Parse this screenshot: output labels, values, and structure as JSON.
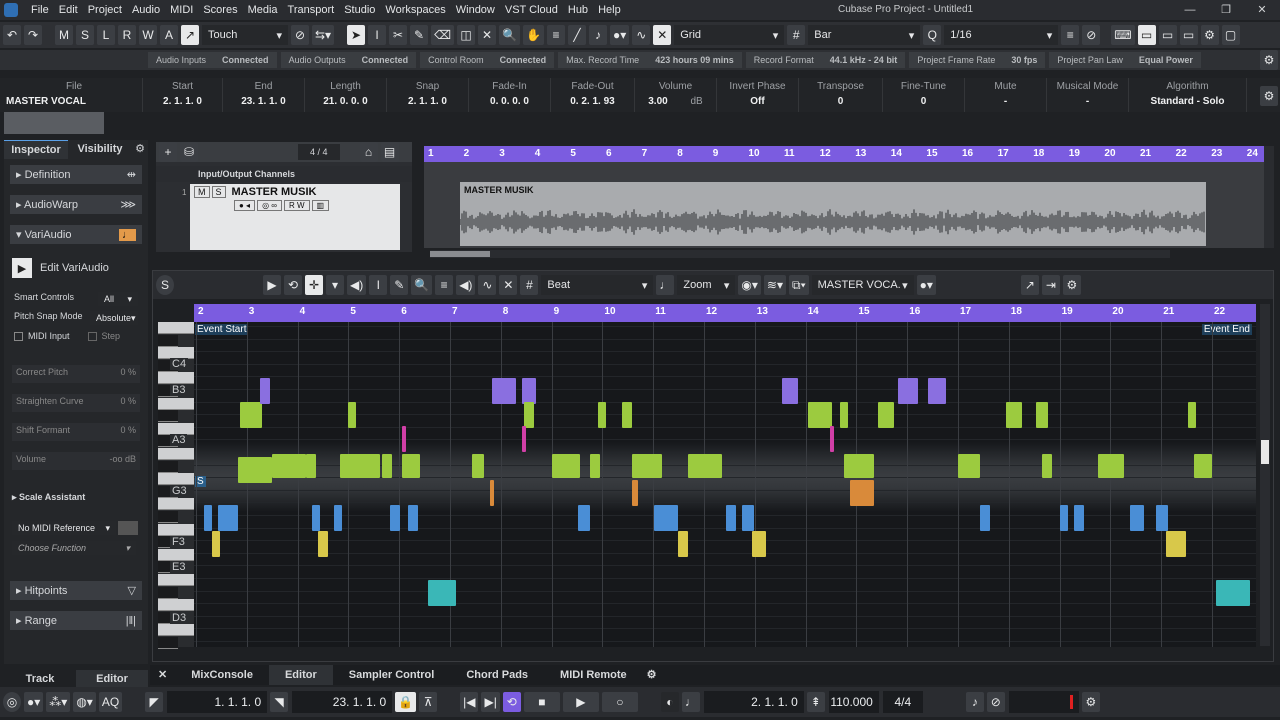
{
  "window": {
    "title": "Cubase Pro Project - Untitled1"
  },
  "menu": [
    "File",
    "Edit",
    "Project",
    "Audio",
    "MIDI",
    "Scores",
    "Media",
    "Transport",
    "Studio",
    "Workspaces",
    "Window",
    "VST Cloud",
    "Hub",
    "Help"
  ],
  "toolbar": {
    "modes": [
      "M",
      "S",
      "L",
      "R",
      "W",
      "A"
    ],
    "automation_mode": "Touch",
    "snap_type": "Grid",
    "grid_type": "Bar",
    "quantize": "1/16"
  },
  "status": [
    {
      "label": "Audio Inputs",
      "value": "Connected"
    },
    {
      "label": "Audio Outputs",
      "value": "Connected"
    },
    {
      "label": "Control Room",
      "value": "Connected"
    },
    {
      "label": "Max. Record Time",
      "value": "423 hours 09 mins"
    },
    {
      "label": "Record Format",
      "value": "44.1 kHz - 24 bit"
    },
    {
      "label": "Project Frame Rate",
      "value": "30 fps"
    },
    {
      "label": "Project Pan Law",
      "value": "Equal Power"
    }
  ],
  "infoline": [
    {
      "h": "File",
      "v": "MASTER VOCAL"
    },
    {
      "h": "Start",
      "v": "2. 1. 1. 0"
    },
    {
      "h": "End",
      "v": "23. 1. 1. 0"
    },
    {
      "h": "Length",
      "v": "21. 0. 0. 0"
    },
    {
      "h": "Snap",
      "v": "2. 1. 1. 0"
    },
    {
      "h": "Fade-In",
      "v": "0. 0. 0. 0"
    },
    {
      "h": "Fade-Out",
      "v": "0. 2. 1. 93"
    },
    {
      "h": "Volume",
      "v": "3.00"
    },
    {
      "h": "Invert Phase",
      "v": "Off"
    },
    {
      "h": "Transpose",
      "v": "0"
    },
    {
      "h": "Fine-Tune",
      "v": "0"
    },
    {
      "h": "Mute",
      "v": "-"
    },
    {
      "h": "Musical Mode",
      "v": "-"
    },
    {
      "h": "Algorithm",
      "v": "Standard - Solo"
    }
  ],
  "volume_unit": "dB",
  "inspector": {
    "tabs": [
      "Inspector",
      "Visibility"
    ],
    "sections": [
      "Definition",
      "AudioWarp",
      "VariAudio"
    ],
    "edit_variaudio": "Edit VariAudio",
    "smart_controls_label": "Smart Controls",
    "smart_controls_value": "All",
    "pitch_snap_label": "Pitch Snap Mode",
    "pitch_snap_value": "Absolute",
    "midi_input": "MIDI Input",
    "step": "Step",
    "correct_pitch": "Correct Pitch",
    "straighten_curve": "Straighten Curve",
    "shift_formant": "Shift Formant",
    "volume": "Volume",
    "pct": "0 %",
    "vol_val": "-oo dB",
    "scale_assistant": "Scale Assistant",
    "no_midi_ref": "No MIDI Reference",
    "choose_function": "Choose Function",
    "hitpoints": "Hitpoints",
    "range": "Range",
    "bottom_tabs": [
      "Track",
      "Editor"
    ]
  },
  "tracklist": {
    "counter": "4 / 4",
    "folder": "Input/Output Channels",
    "track_name": "MASTER MUSIK",
    "track_num": "1"
  },
  "arrange": {
    "event_name": "MASTER MUSIK",
    "bars": [
      "1",
      "2",
      "3",
      "4",
      "5",
      "6",
      "7",
      "8",
      "9",
      "10",
      "11",
      "12",
      "13",
      "14",
      "15",
      "16",
      "17",
      "18",
      "19",
      "20",
      "21",
      "22",
      "23",
      "24"
    ]
  },
  "editor": {
    "beat": "Beat",
    "zoom": "Zoom",
    "track": "MASTER VOCA.",
    "event_start": "Event Start",
    "event_end": "Event End",
    "bars": [
      "2",
      "3",
      "4",
      "5",
      "6",
      "7",
      "8",
      "9",
      "10",
      "11",
      "12",
      "13",
      "14",
      "15",
      "16",
      "17",
      "18",
      "19",
      "20",
      "21",
      "22"
    ],
    "keys": [
      "C4",
      "B3",
      "A3",
      "G3",
      "F3",
      "E3",
      "D3"
    ],
    "s_marker": "S"
  },
  "bottom_tabs": [
    "MixConsole",
    "Editor",
    "Sampler Control",
    "Chord Pads",
    "MIDI Remote"
  ],
  "transport": {
    "aq": "AQ",
    "left_locator": "1. 1. 1. 0",
    "right_locator": "23. 1. 1. 0",
    "position": "2. 1. 1. 0",
    "tempo": "110.000",
    "signature": "4/4"
  }
}
